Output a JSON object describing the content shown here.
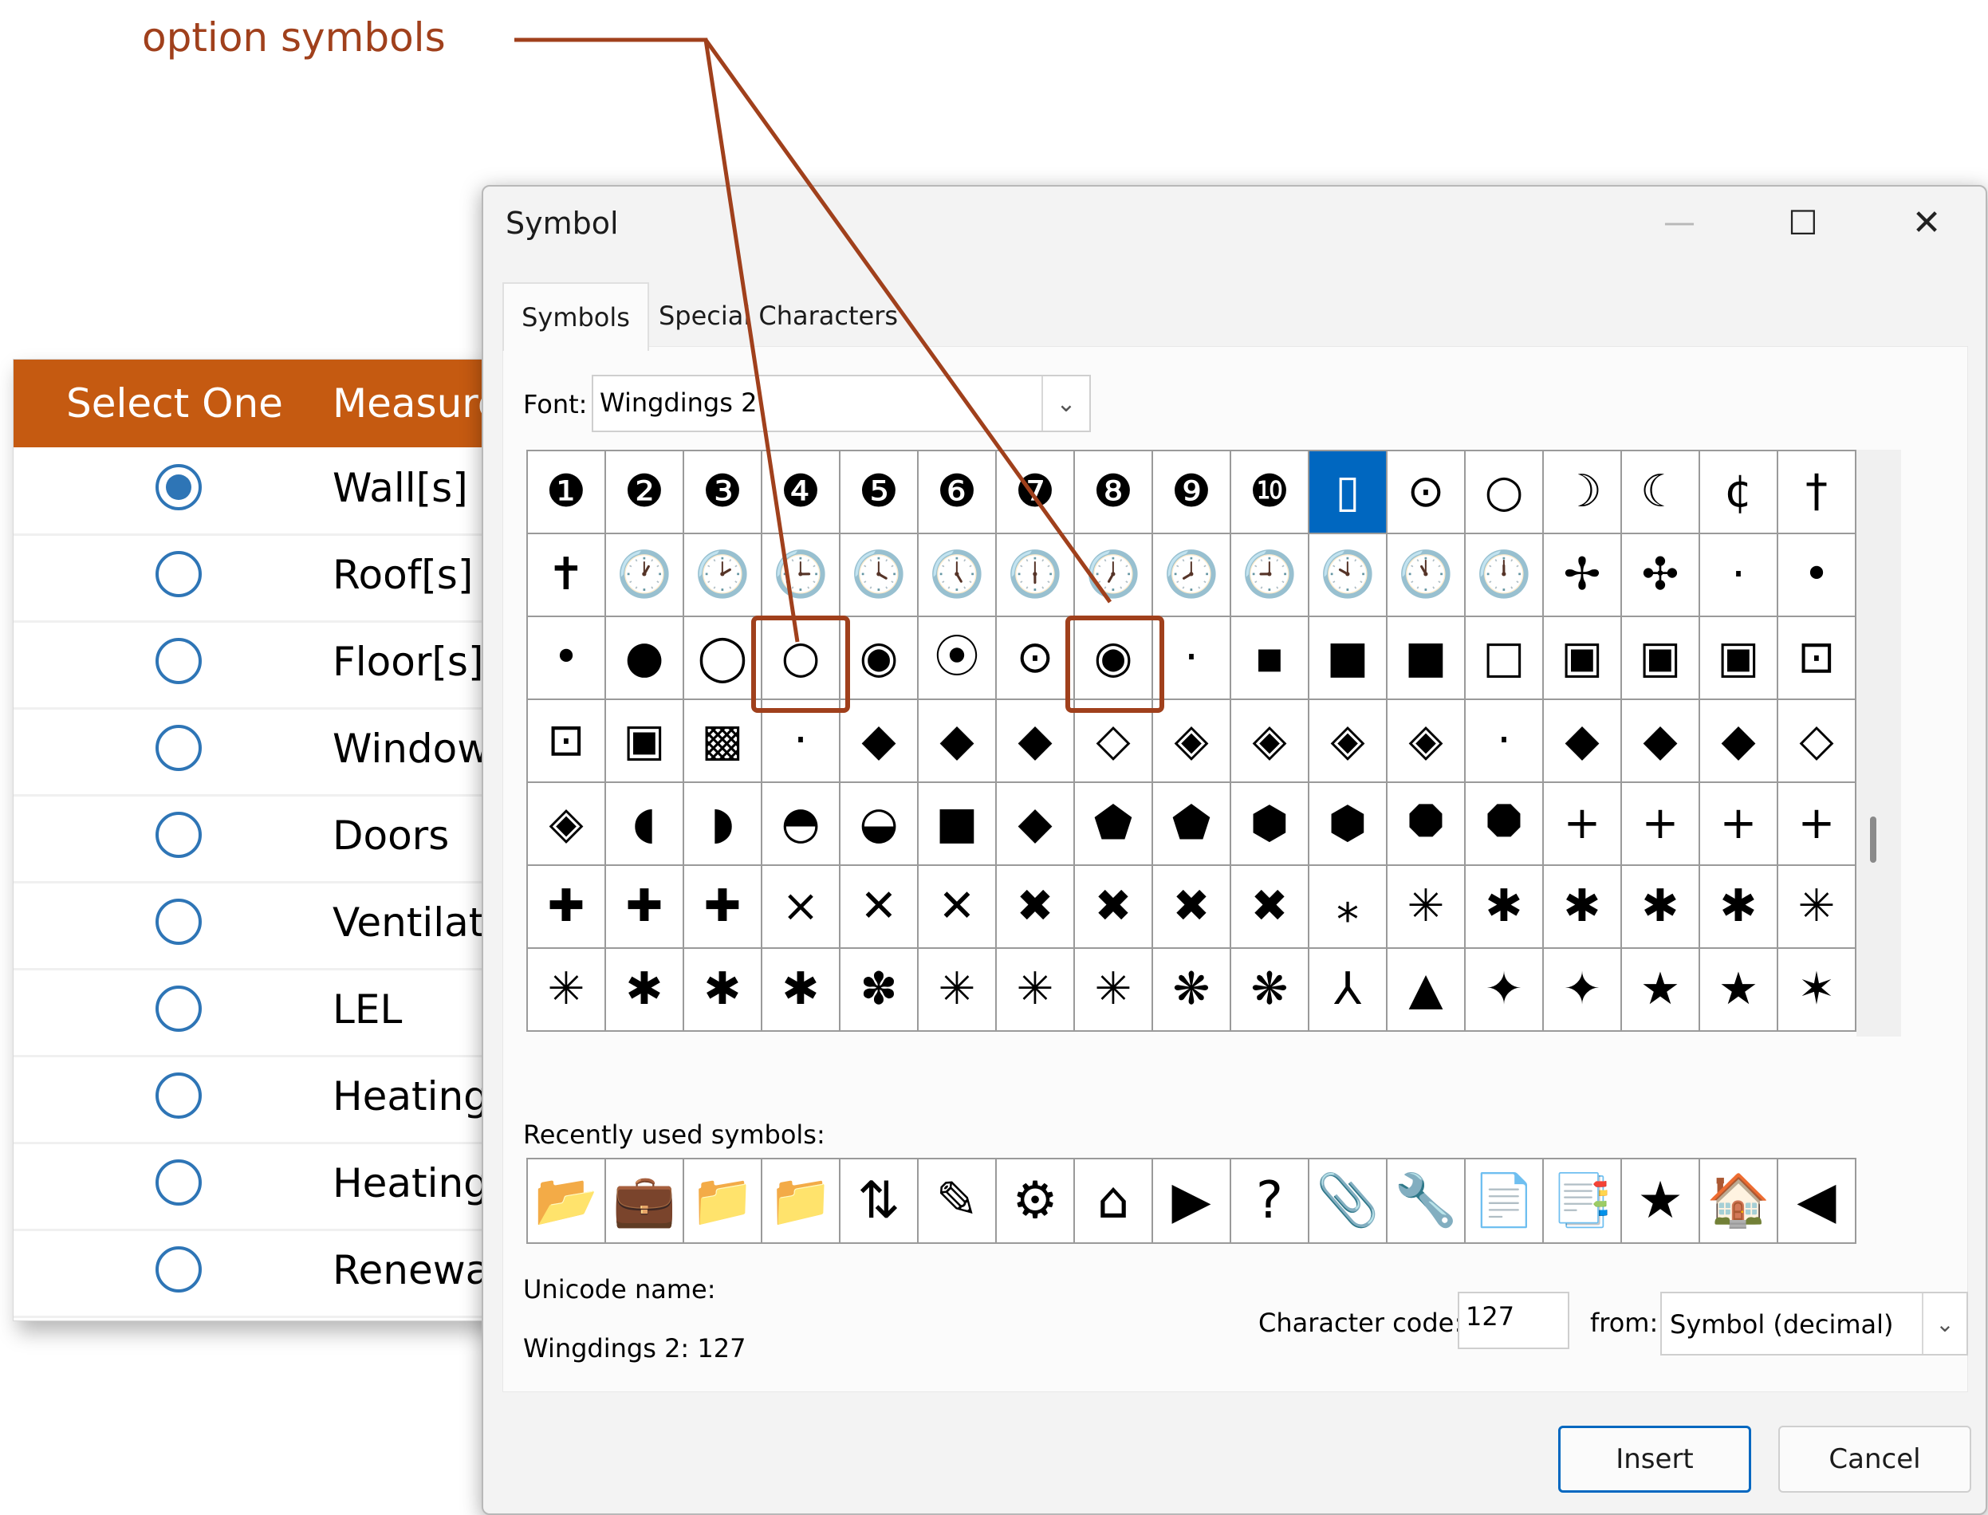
{
  "annotation": {
    "label": "option symbols",
    "color": "#a0401c"
  },
  "background_table": {
    "headers": [
      "Select One",
      "Measure"
    ],
    "rows": [
      {
        "label": "Wall[s]",
        "selected": true
      },
      {
        "label": "Roof[s]",
        "selected": false
      },
      {
        "label": "Floor[s]",
        "selected": false
      },
      {
        "label": "Window",
        "selected": false
      },
      {
        "label": "Doors",
        "selected": false
      },
      {
        "label": "Ventilat",
        "selected": false
      },
      {
        "label": "LEL",
        "selected": false
      },
      {
        "label": "Heating",
        "selected": false
      },
      {
        "label": "Heating",
        "selected": false
      },
      {
        "label": "Renewa",
        "selected": false
      }
    ],
    "header_color": "#c55a11",
    "radio_color": "#2e75b6"
  },
  "dialog": {
    "title": "Symbol",
    "controls": {
      "minimize": "—",
      "maximize": "☐",
      "close": "✕"
    },
    "tabs": [
      "Symbols",
      "Special Characters"
    ],
    "font_label": "Font:",
    "font_value": "Wingdings 2",
    "symbols": [
      [
        "❶",
        "❷",
        "❸",
        "❹",
        "❺",
        "❻",
        "❼",
        "❽",
        "❾",
        "❿",
        "▯",
        "⊙",
        "○",
        "☽",
        "☾",
        "¢",
        "†"
      ],
      [
        "✝",
        "🕐",
        "🕑",
        "🕒",
        "🕓",
        "🕔",
        "🕕",
        "🕖",
        "🕗",
        "🕘",
        "🕙",
        "🕚",
        "🕛",
        "✢",
        "✣",
        "·",
        "•"
      ],
      [
        "•",
        "●",
        "◯",
        "○",
        "◉",
        "⦿",
        "⊙",
        "◉",
        "·",
        "▪",
        "■",
        "■",
        "□",
        "▣",
        "▣",
        "▣",
        "⊡"
      ],
      [
        "⊡",
        "▣",
        "▩",
        "·",
        "◆",
        "◆",
        "◆",
        "◇",
        "◈",
        "◈",
        "◈",
        "◈",
        "·",
        "◆",
        "◆",
        "◆",
        "◇"
      ],
      [
        "◈",
        "◖",
        "◗",
        "◓",
        "◒",
        "■",
        "◆",
        "⬟",
        "⬟",
        "⬢",
        "⬢",
        "⯃",
        "⯃",
        "+",
        "+",
        "+",
        "+"
      ],
      [
        "✚",
        "✚",
        "✚",
        "×",
        "✕",
        "✕",
        "✖",
        "✖",
        "✖",
        "✖",
        "⁎",
        "✳",
        "✱",
        "✱",
        "✱",
        "✱",
        "✳"
      ],
      [
        "✳",
        "✱",
        "✱",
        "✱",
        "✽",
        "✳",
        "✳",
        "✳",
        "❋",
        "❋",
        "⅄",
        "▲",
        "✦",
        "✦",
        "★",
        "★",
        "✶"
      ]
    ],
    "selected_symbol_index": [
      0,
      10
    ],
    "recent_label": "Recently used symbols:",
    "recent_symbols": [
      "📂",
      "💼",
      "📁",
      "📁",
      "⇅",
      "✎",
      "⚙",
      "⌂",
      "▶",
      "?",
      "📎",
      "🔧",
      "📄",
      "📑",
      "★",
      "🏠",
      "◀"
    ],
    "unicode_name_label": "Unicode name:",
    "unicode_name_value": "Wingdings 2: 127",
    "character_code_label": "Character code:",
    "character_code_value": "127",
    "from_label": "from:",
    "from_value": "Symbol (decimal)",
    "buttons": {
      "insert": "Insert",
      "cancel": "Cancel"
    },
    "accent_color": "#0067c0"
  }
}
